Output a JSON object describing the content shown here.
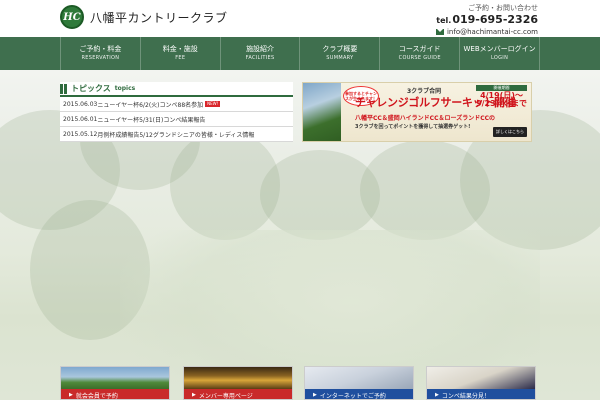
{
  "header": {
    "logo_mark": "HC",
    "site_name": "八幡平カントリークラブ",
    "contact_caption": "ご予約・お問い合わせ",
    "tel_prefix": "tel.",
    "tel": "019-695-2326",
    "email": "info@hachimantai-cc.com"
  },
  "nav": [
    {
      "jp": "ご予約・料金",
      "en": "RESERVATION"
    },
    {
      "jp": "料金・施設",
      "en": "FEE"
    },
    {
      "jp": "施設紹介",
      "en": "FACILITIES"
    },
    {
      "jp": "クラブ概要",
      "en": "SUMMARY"
    },
    {
      "jp": "コースガイド",
      "en": "COURSE GUIDE"
    },
    {
      "jp": "WEBメンバーログイン",
      "en": "LOGIN"
    }
  ],
  "topics": {
    "title": "トピックス",
    "title_en": "topics",
    "items": [
      {
        "date": "2015.06.03",
        "text": "ニューイヤー杯6/2(火)コンペ88名参加",
        "new": "NEW!"
      },
      {
        "date": "2015.06.01",
        "text": "ニューイヤー杯5/31(日)コンペ結果報告",
        "new": ""
      },
      {
        "date": "2015.05.12",
        "text": "月例杯成績報告5/12グランドシニアの皆様・レディス情報",
        "new": ""
      }
    ]
  },
  "banner": {
    "bubble": "参加するとチャンスが生まれます！",
    "pre": "3クラブ合同",
    "title": "チャレンジゴルフサーキット開催",
    "date_badge": "開催期間",
    "date1": "4/19(日)～",
    "date2": "9/23(水)まで",
    "clubs": "八幡平CC＆盛岡ハイランドCC＆ローズランドCCの",
    "desc": "3クラブを回ってポイントを獲得して抽選券ゲット!",
    "detail": "詳しくはこちら"
  },
  "cards": [
    {
      "label": "就会会員で予約",
      "color": "#c92a2a"
    },
    {
      "label": "メンバー専用ページ",
      "color": "#c92a2a"
    },
    {
      "label": "インターネットでご予約",
      "color": "#1f4f9e"
    },
    {
      "label": "コンペ結果分見！",
      "color": "#1f4f9e"
    }
  ]
}
